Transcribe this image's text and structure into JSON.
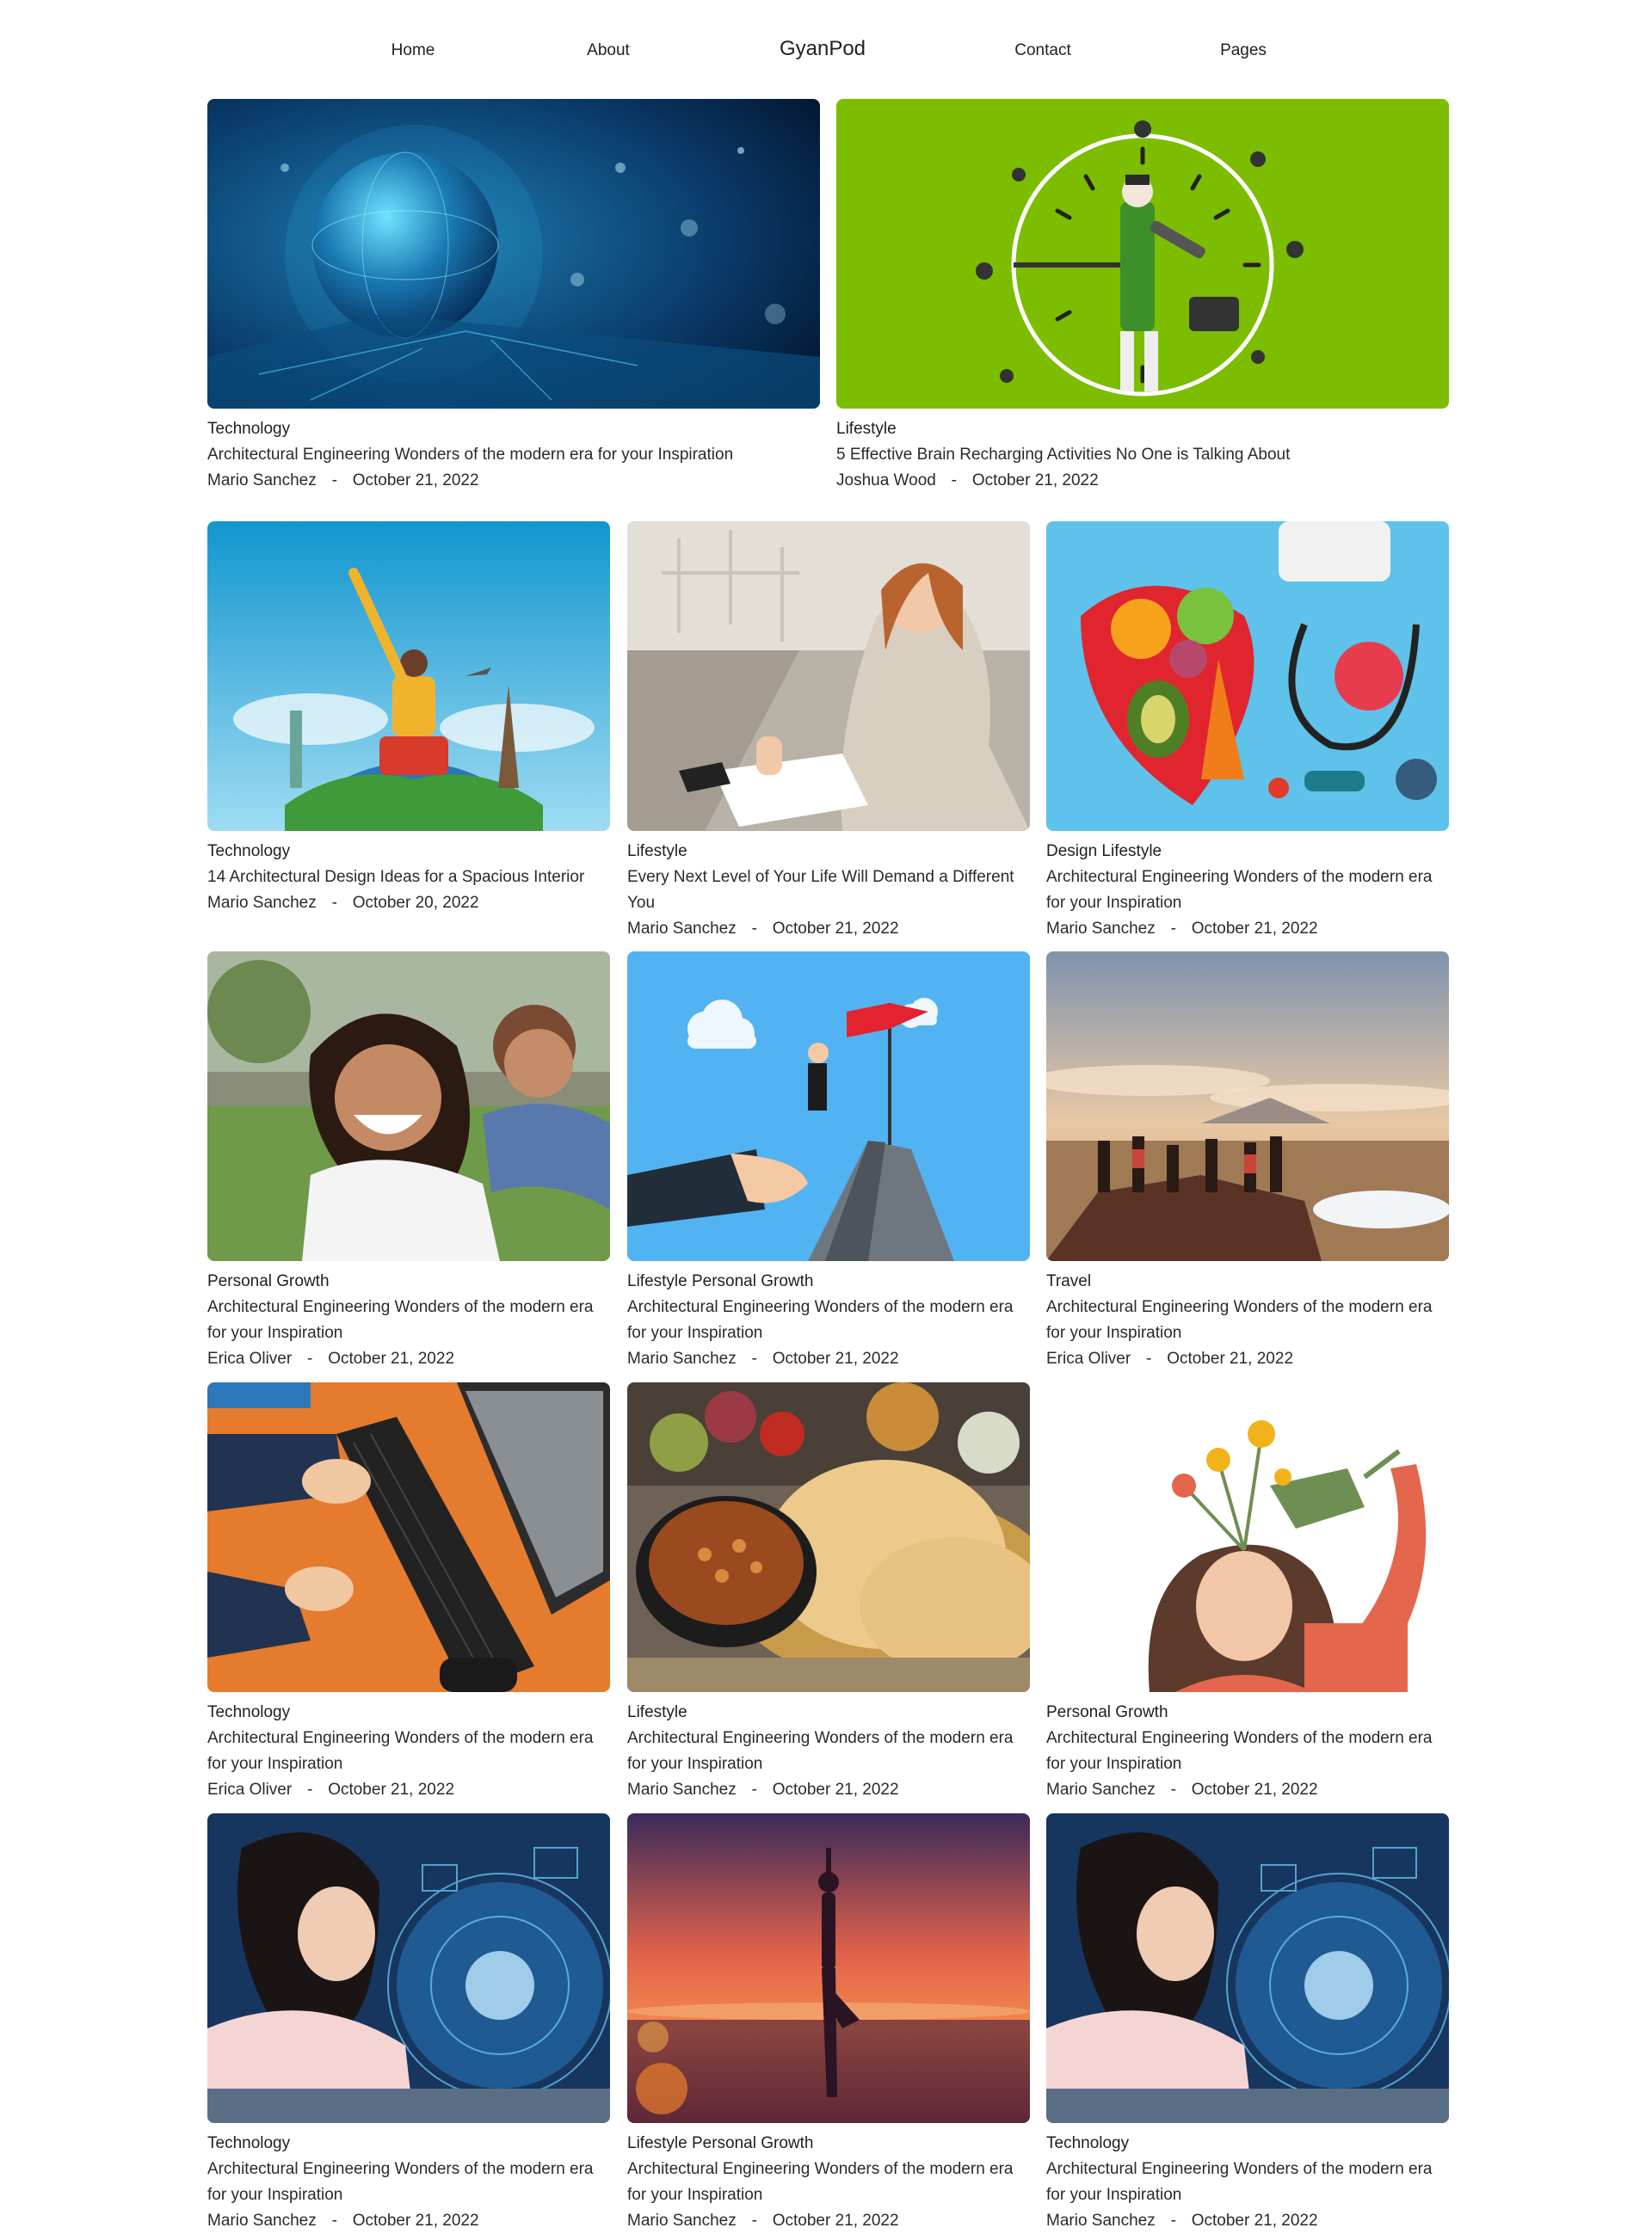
{
  "nav": {
    "home": "Home",
    "about": "About",
    "brand": "GyanPod",
    "contact": "Contact",
    "pages": "Pages"
  },
  "separator": "-",
  "featured": [
    {
      "category": "Technology",
      "title": "Architectural Engineering Wonders of the modern era for your Inspiration",
      "author": "Mario Sanchez",
      "date": "October 21, 2022"
    },
    {
      "category": "Lifestyle",
      "title": "5 Effective Brain Recharging Activities No One is Talking About",
      "author": "Joshua Wood",
      "date": "October 21, 2022"
    }
  ],
  "posts": [
    {
      "category": "Technology",
      "title": "14 Architectural Design Ideas for a Spacious Interior",
      "author": "Mario Sanchez",
      "date": "October 20, 2022"
    },
    {
      "category": "Lifestyle",
      "title": "Every Next Level of Your Life Will Demand a Different You",
      "author": "Mario Sanchez",
      "date": "October 21, 2022"
    },
    {
      "category": "Design Lifestyle",
      "title": "Architectural Engineering Wonders of the modern era for your Inspiration",
      "author": "Mario Sanchez",
      "date": "October 21, 2022"
    },
    {
      "category": "Personal Growth",
      "title": "Architectural Engineering Wonders of the modern era for your Inspiration",
      "author": "Erica Oliver",
      "date": "October 21, 2022"
    },
    {
      "category": "Lifestyle Personal Growth",
      "title": "Architectural Engineering Wonders of the modern era for your Inspiration",
      "author": "Mario Sanchez",
      "date": "October 21, 2022"
    },
    {
      "category": "Travel",
      "title": "Architectural Engineering Wonders of the modern era for your Inspiration",
      "author": "Erica Oliver",
      "date": "October 21, 2022"
    },
    {
      "category": "Technology",
      "title": "Architectural Engineering Wonders of the modern era for your Inspiration",
      "author": "Erica Oliver",
      "date": "October 21, 2022"
    },
    {
      "category": "Lifestyle",
      "title": "Architectural Engineering Wonders of the modern era for your Inspiration",
      "author": "Mario Sanchez",
      "date": "October 21, 2022"
    },
    {
      "category": "Personal Growth",
      "title": "Architectural Engineering Wonders of the modern era for your Inspiration",
      "author": "Mario Sanchez",
      "date": "October 21, 2022"
    },
    {
      "category": "Technology",
      "title": "Architectural Engineering Wonders of the modern era for your Inspiration",
      "author": "Mario Sanchez",
      "date": "October 21, 2022"
    },
    {
      "category": "Lifestyle Personal Growth",
      "title": "Architectural Engineering Wonders of the modern era for your Inspiration",
      "author": "Mario Sanchez",
      "date": "October 21, 2022"
    },
    {
      "category": "Technology",
      "title": "Architectural Engineering Wonders of the modern era for your Inspiration",
      "author": "Mario Sanchez",
      "date": "October 21, 2022"
    }
  ]
}
